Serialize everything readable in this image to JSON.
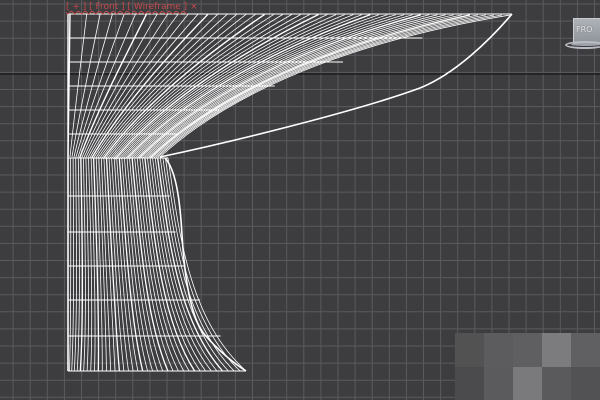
{
  "viewport": {
    "label": "[ + ] [ Front ] [ Wireframe ]",
    "label_close_glyph": "×",
    "label_color": "#c24a4a",
    "view_cube_face": "FRO",
    "background_color": "#3d3c3f",
    "grid_color": "#5b5b5f",
    "horizon_line_color": "#0b0b0b",
    "wire_color": "#ffffff"
  },
  "thumbnail": {
    "colors": [
      "#525252",
      "#5c5b5d",
      "#5f5e60",
      "#7c7b7e",
      "#606062",
      "#4b4a4c",
      "#5b5a5c",
      "#7a797b",
      "#5a5a5c",
      "#525254"
    ]
  }
}
